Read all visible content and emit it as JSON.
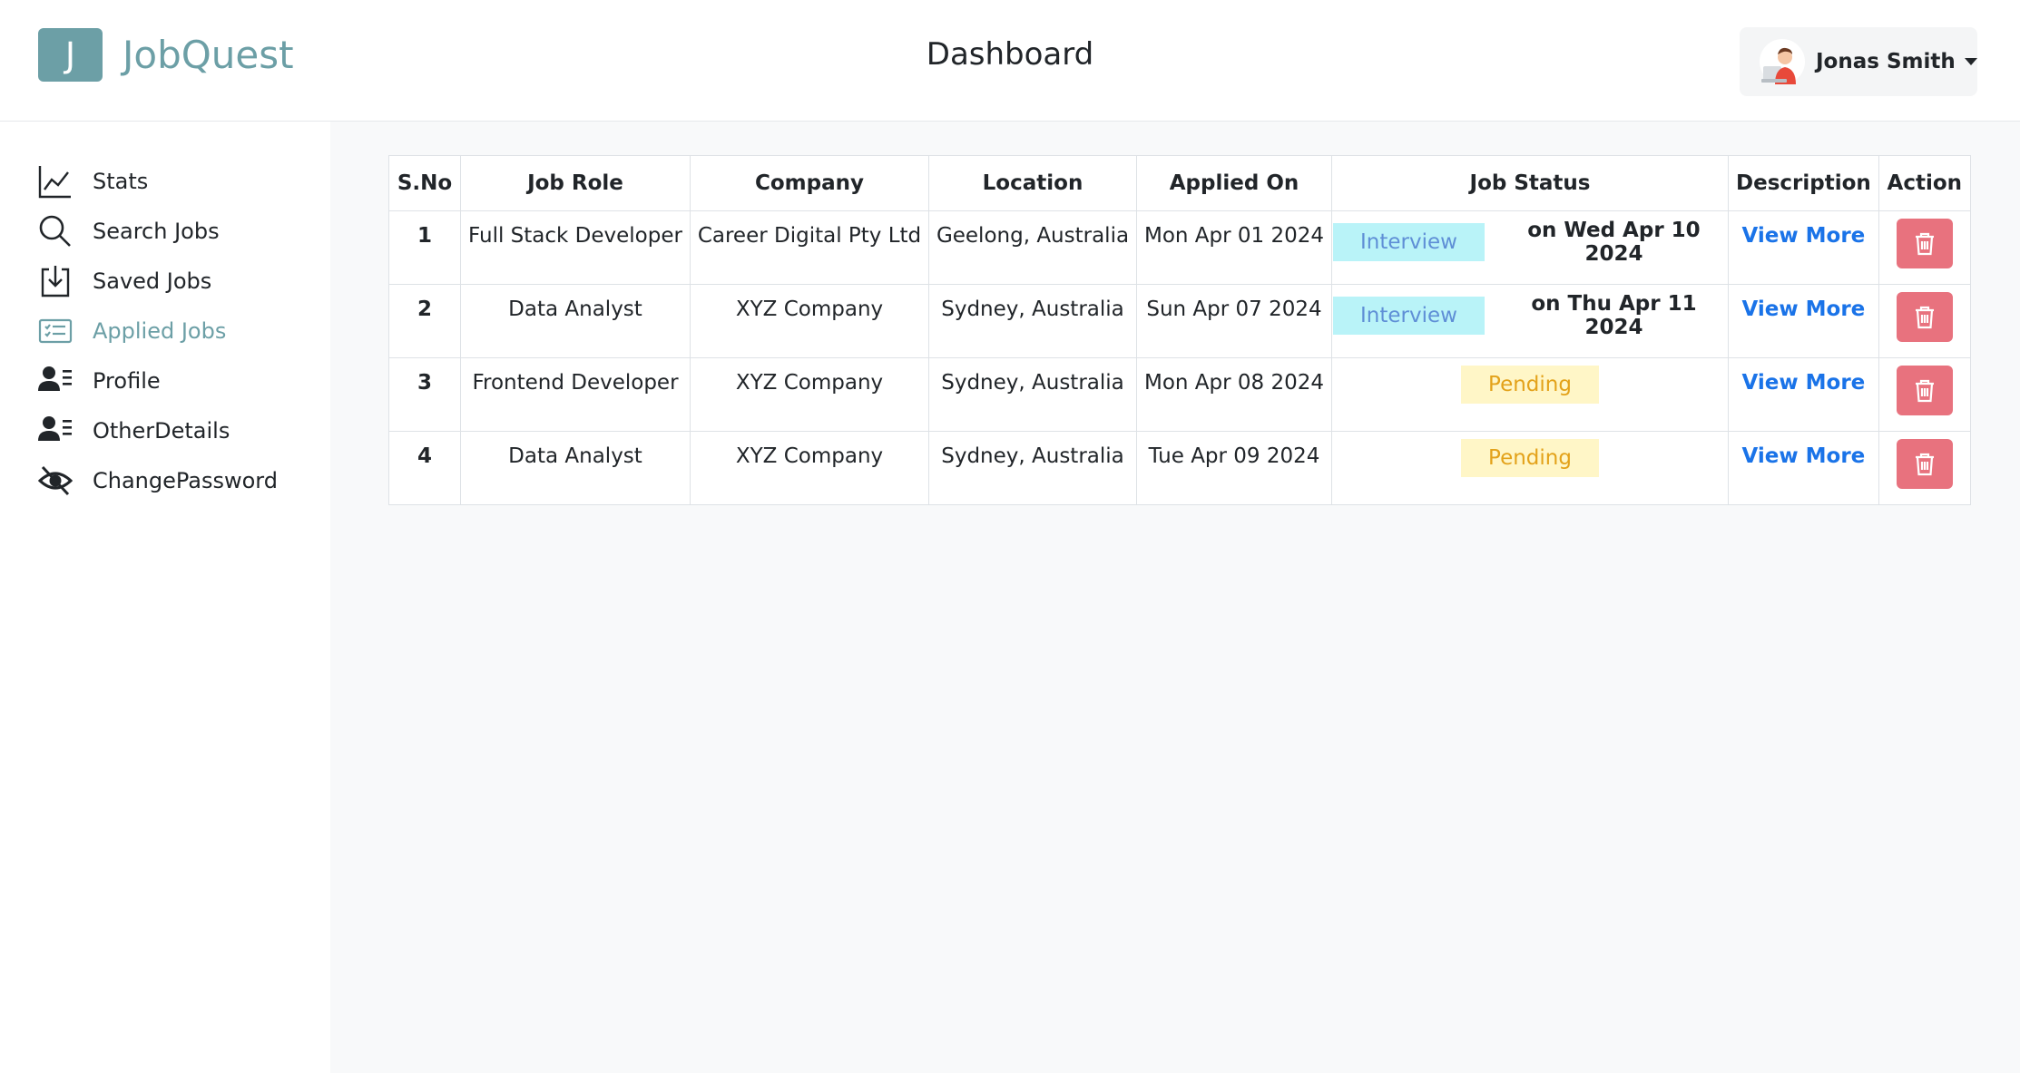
{
  "brand": {
    "logo_letter": "J",
    "name": "JobQuest",
    "color": "#6c9fa6"
  },
  "header": {
    "title": "Dashboard"
  },
  "user": {
    "name": "Jonas Smith"
  },
  "sidebar": {
    "items": [
      {
        "label": "Stats",
        "icon": "line-chart-icon"
      },
      {
        "label": "Search Jobs",
        "icon": "search-icon"
      },
      {
        "label": "Saved Jobs",
        "icon": "download-box-icon"
      },
      {
        "label": "Applied Jobs",
        "icon": "card-list-icon",
        "active": true
      },
      {
        "label": "Profile",
        "icon": "person-lines-icon"
      },
      {
        "label": "OtherDetails",
        "icon": "person-lines-icon"
      },
      {
        "label": "ChangePassword",
        "icon": "eye-slash-icon"
      }
    ]
  },
  "table": {
    "columns": [
      "S.No",
      "Job Role",
      "Company",
      "Location",
      "Applied On",
      "Job Status",
      "Description",
      "Action"
    ],
    "rows": [
      {
        "sno": "1",
        "role": "Full Stack Developer",
        "company": "Career Digital Pty Ltd",
        "location": "Geelong, Australia",
        "applied_on": "Mon Apr 01 2024",
        "status": "Interview",
        "status_date": "on Wed Apr 10 2024",
        "description": "View More"
      },
      {
        "sno": "2",
        "role": "Data Analyst",
        "company": "XYZ Company",
        "location": "Sydney, Australia",
        "applied_on": "Sun Apr 07 2024",
        "status": "Interview",
        "status_date": "on Thu Apr 11 2024",
        "description": "View More"
      },
      {
        "sno": "3",
        "role": "Frontend Developer",
        "company": "XYZ Company",
        "location": "Sydney, Australia",
        "applied_on": "Mon Apr 08 2024",
        "status": "Pending",
        "status_date": "",
        "description": "View More"
      },
      {
        "sno": "4",
        "role": "Data Analyst",
        "company": "XYZ Company",
        "location": "Sydney, Australia",
        "applied_on": "Tue Apr 09 2024",
        "status": "Pending",
        "status_date": "",
        "description": "View More"
      }
    ]
  },
  "colors": {
    "interview_bg": "#b9f3f8",
    "interview_text": "#5f8fd6",
    "pending_bg": "#fff6c7",
    "pending_text": "#e3a21a",
    "link": "#1a73e8",
    "delete": "#e8727e"
  }
}
